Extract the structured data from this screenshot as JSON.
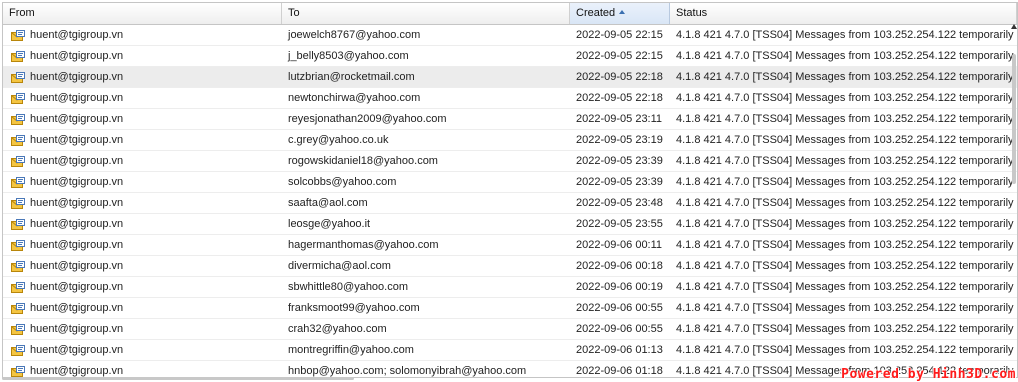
{
  "columns": {
    "from": "From",
    "to": "To",
    "created": "Created",
    "status": "Status"
  },
  "sort": {
    "column": "Created",
    "direction": "ascending"
  },
  "highlight_row": 2,
  "rows": [
    {
      "from": "huent@tgigroup.vn",
      "to": "joewelch8767@yahoo.com",
      "created": "2022-09-05 22:15",
      "status": "4.1.8 421 4.7.0 [TSS04] Messages from 103.252.254.122 temporarily"
    },
    {
      "from": "huent@tgigroup.vn",
      "to": "j_belly8503@yahoo.com",
      "created": "2022-09-05 22:15",
      "status": "4.1.8 421 4.7.0 [TSS04] Messages from 103.252.254.122 temporarily"
    },
    {
      "from": "huent@tgigroup.vn",
      "to": "lutzbrian@rocketmail.com",
      "created": "2022-09-05 22:18",
      "status": "4.1.8 421 4.7.0 [TSS04] Messages from 103.252.254.122 temporarily"
    },
    {
      "from": "huent@tgigroup.vn",
      "to": "newtonchirwa@yahoo.com",
      "created": "2022-09-05 22:18",
      "status": "4.1.8 421 4.7.0 [TSS04] Messages from 103.252.254.122 temporarily"
    },
    {
      "from": "huent@tgigroup.vn",
      "to": "reyesjonathan2009@yahoo.com",
      "created": "2022-09-05 23:11",
      "status": "4.1.8 421 4.7.0 [TSS04] Messages from 103.252.254.122 temporarily"
    },
    {
      "from": "huent@tgigroup.vn",
      "to": "c.grey@yahoo.co.uk",
      "created": "2022-09-05 23:19",
      "status": "4.1.8 421 4.7.0 [TSS04] Messages from 103.252.254.122 temporarily"
    },
    {
      "from": "huent@tgigroup.vn",
      "to": "rogowskidaniel18@yahoo.com",
      "created": "2022-09-05 23:39",
      "status": "4.1.8 421 4.7.0 [TSS04] Messages from 103.252.254.122 temporarily"
    },
    {
      "from": "huent@tgigroup.vn",
      "to": "solcobbs@yahoo.com",
      "created": "2022-09-05 23:39",
      "status": "4.1.8 421 4.7.0 [TSS04] Messages from 103.252.254.122 temporarily"
    },
    {
      "from": "huent@tgigroup.vn",
      "to": "saafta@aol.com",
      "created": "2022-09-05 23:48",
      "status": "4.1.8 421 4.7.0 [TSS04] Messages from 103.252.254.122 temporarily"
    },
    {
      "from": "huent@tgigroup.vn",
      "to": "leosge@yahoo.it",
      "created": "2022-09-05 23:55",
      "status": "4.1.8 421 4.7.0 [TSS04] Messages from 103.252.254.122 temporarily"
    },
    {
      "from": "huent@tgigroup.vn",
      "to": "hagermanthomas@yahoo.com",
      "created": "2022-09-06 00:11",
      "status": "4.1.8 421 4.7.0 [TSS04] Messages from 103.252.254.122 temporarily"
    },
    {
      "from": "huent@tgigroup.vn",
      "to": "divermicha@aol.com",
      "created": "2022-09-06 00:18",
      "status": "4.1.8 421 4.7.0 [TSS04] Messages from 103.252.254.122 temporarily"
    },
    {
      "from": "huent@tgigroup.vn",
      "to": "sbwhittle80@yahoo.com",
      "created": "2022-09-06 00:19",
      "status": "4.1.8 421 4.7.0 [TSS04] Messages from 103.252.254.122 temporarily"
    },
    {
      "from": "huent@tgigroup.vn",
      "to": "franksmoot99@yahoo.com",
      "created": "2022-09-06 00:55",
      "status": "4.1.8 421 4.7.0 [TSS04] Messages from 103.252.254.122 temporarily"
    },
    {
      "from": "huent@tgigroup.vn",
      "to": "crah32@yahoo.com",
      "created": "2022-09-06 00:55",
      "status": "4.1.8 421 4.7.0 [TSS04] Messages from 103.252.254.122 temporarily"
    },
    {
      "from": "huent@tgigroup.vn",
      "to": "montregriffin@yahoo.com",
      "created": "2022-09-06 01:13",
      "status": "4.1.8 421 4.7.0 [TSS04] Messages from 103.252.254.122 temporarily"
    },
    {
      "from": "huent@tgigroup.vn",
      "to": "hnbop@yahoo.com; solomonyibrah@yahoo.com",
      "created": "2022-09-06 01:18",
      "status": "4.1.8 421 4.7.0 [TSS04] Messages from 103.252.254.122 temporarily"
    }
  ],
  "icons": {
    "row_icon": "mail-envelope-icon",
    "sort_icon": "sort-ascending-icon"
  },
  "colors": {
    "header_sorted": "#d9e6f6",
    "row_highlight": "#ececec",
    "watermark": "#ff1a1a"
  },
  "watermark": "Powered by Hinh3D.com"
}
